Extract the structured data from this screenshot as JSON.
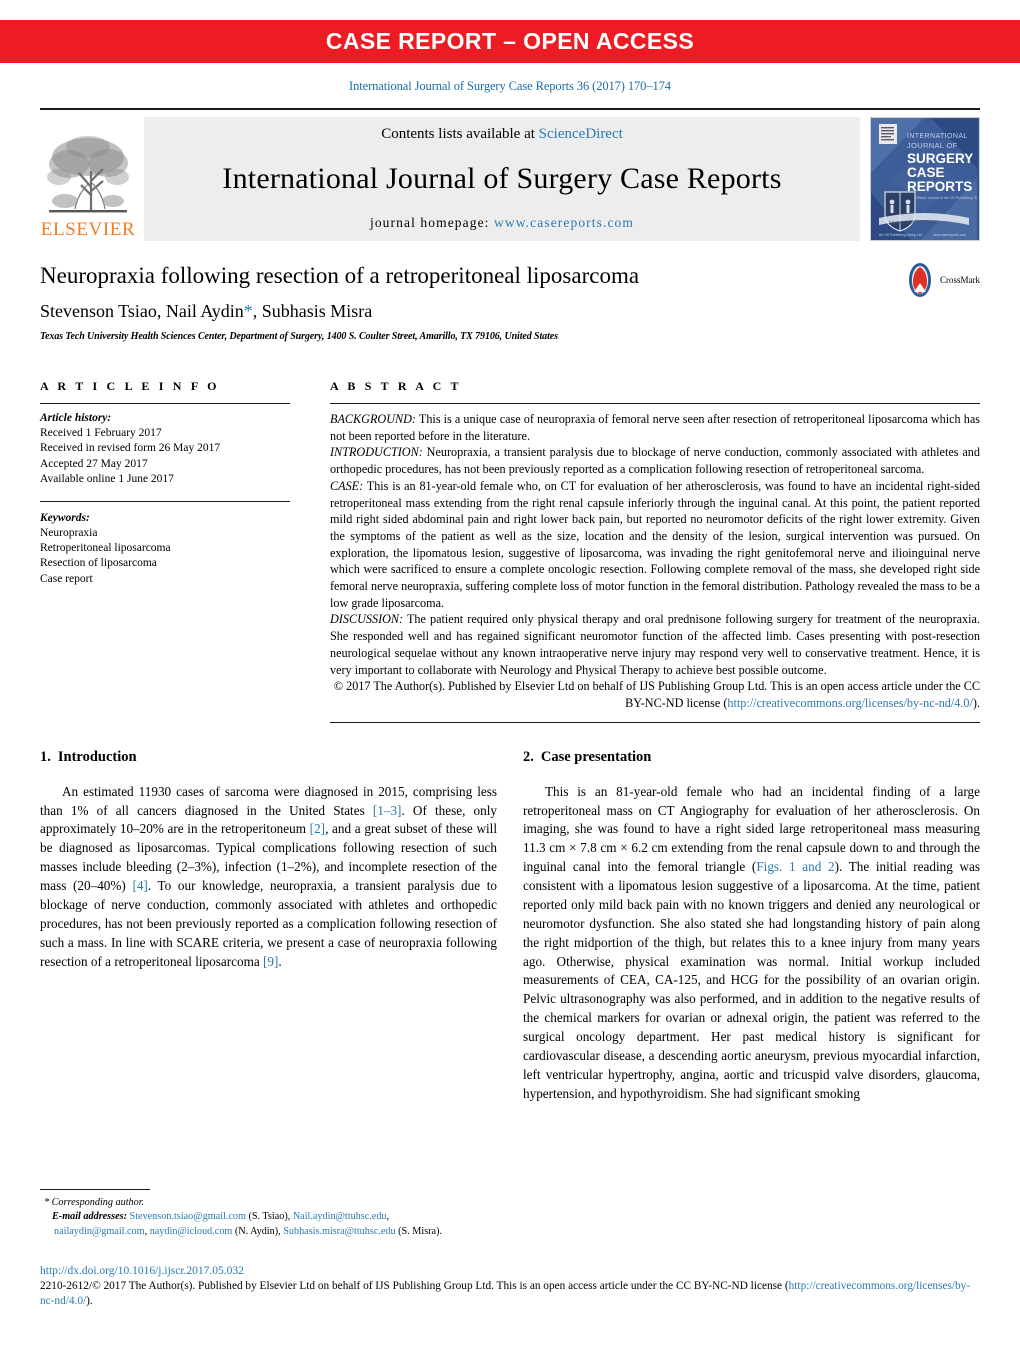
{
  "banner": {
    "text": "CASE REPORT – OPEN ACCESS"
  },
  "citation": "International Journal of Surgery Case Reports 36 (2017) 170–174",
  "masthead": {
    "contents_prefix": "Contents lists available at ",
    "sciencedirect": "ScienceDirect",
    "journal_title": "International Journal of Surgery Case Reports",
    "homepage_prefix": "journal homepage: ",
    "homepage_url": "www.casereports.com",
    "elsevier_wordmark": "ELSEVIER",
    "cover": {
      "line1": "INTERNATIONAL",
      "line2": "JOURNAL OF",
      "line3": "SURGERY",
      "line4": "CASE",
      "line5": "REPORTS"
    }
  },
  "article": {
    "title": "Neuropraxia following resection of a retroperitoneal liposarcoma",
    "authors_pre": "Stevenson Tsiao, Nail Aydin",
    "authors_star": "*",
    "authors_post": ", Subhasis Misra",
    "affiliation": "Texas Tech University Health Sciences Center, Department of Surgery, 1400 S. Coulter Street, Amarillo, TX 79106, United States",
    "crossmark_label": "CrossMark"
  },
  "article_info": {
    "heading": "A R T I C L E   I N F O",
    "history_label": "Article history:",
    "history": [
      "Received 1 February 2017",
      "Received in revised form 26 May 2017",
      "Accepted 27 May 2017",
      "Available online 1 June 2017"
    ],
    "keywords_label": "Keywords:",
    "keywords": [
      "Neuropraxia",
      "Retroperitoneal liposarcoma",
      "Resection of liposarcoma",
      "Case report"
    ]
  },
  "abstract": {
    "heading": "A B S T R A C T",
    "background_tag": "BACKGROUND:",
    "background_text": " This is a unique case of neuropraxia of femoral nerve seen after resection of retroperitoneal liposarcoma which has not been reported before in the literature.",
    "introduction_tag": "INTRODUCTION:",
    "introduction_text": " Neuropraxia, a transient paralysis due to blockage of nerve conduction, commonly associated with athletes and orthopedic procedures, has not been previously reported as a complication following resection of retroperitoneal sarcoma.",
    "case_tag": "CASE:",
    "case_text": " This is an 81-year-old female who, on CT for evaluation of her atherosclerosis, was found to have an incidental right-sided retroperitoneal mass extending from the right renal capsule inferiorly through the inguinal canal. At this point, the patient reported mild right sided abdominal pain and right lower back pain, but reported no neuromotor deficits of the right lower extremity. Given the symptoms of the patient as well as the size, location and the density of the lesion, surgical intervention was pursued. On exploration, the lipomatous lesion, suggestive of liposarcoma, was invading the right genitofemoral nerve and ilioinguinal nerve which were sacrificed to ensure a complete oncologic resection. Following complete removal of the mass, she developed right side femoral nerve neuropraxia, suffering complete loss of motor function in the femoral distribution. Pathology revealed the mass to be a low grade liposarcoma.",
    "discussion_tag": "DISCUSSION:",
    "discussion_text": " The patient required only physical therapy and oral prednisone following surgery for treatment of the neuropraxia. She responded well and has regained significant neuromotor function of the affected limb. Cases presenting with post-resection neurological sequelae without any known intraoperative nerve injury may respond very well to conservative treatment. Hence, it is very important to collaborate with Neurology and Physical Therapy to achieve best possible outcome.",
    "copyright_text": "© 2017 The Author(s). Published by Elsevier Ltd on behalf of IJS Publishing Group Ltd. This is an open access article under the CC BY-NC-ND license (",
    "copyright_link": "http://creativecommons.org/licenses/by-nc-nd/4.0/",
    "copyright_tail": ")."
  },
  "sections": {
    "introduction": {
      "number": "1.",
      "heading": "Introduction",
      "p1_a": "An estimated 11930 cases of sarcoma were diagnosed in 2015, comprising less than 1% of all cancers diagnosed in the United States ",
      "ref1": "[1–3]",
      "p1_b": ". Of these, only approximately 10–20% are in the retroperitoneum ",
      "ref2": "[2]",
      "p1_c": ", and a great subset of these will be diagnosed as liposarcomas. Typical complications following resection of such masses include bleeding (2–3%), infection (1–2%), and incomplete resection of the mass (20–40%) ",
      "ref3": "[4]",
      "p1_d": ". To our knowledge, neuropraxia, a transient paralysis due to blockage of nerve conduction, commonly associated with athletes and orthopedic procedures, has not been previously reported as a complication following resection of such a mass. In line with SCARE criteria, we present a case of neuropraxia following resection of a retroperitoneal liposarcoma ",
      "ref4": "[9]",
      "p1_e": "."
    },
    "case_presentation": {
      "number": "2.",
      "heading": "Case presentation",
      "p1_a": "This is an 81-year-old female who had an incidental finding of a large retroperitoneal mass on CT Angiography for evaluation of her atherosclerosis. On imaging, she was found to have a right sided large retroperitoneal mass measuring 11.3 cm × 7.8 cm × 6.2 cm extending from the renal capsule down to and through the inguinal canal into the femoral triangle (",
      "figref": "Figs. 1 and 2",
      "p1_b": "). The initial reading was consistent with a lipomatous lesion suggestive of a liposarcoma. At the time, patient reported only mild back pain with no known triggers and denied any neurological or neuromotor dysfunction. She also stated she had longstanding history of pain along the right midportion of the thigh, but relates this to a knee injury from many years ago. Otherwise, physical examination was normal. Initial workup included measurements of CEA, CA-125, and HCG for the possibility of an ovarian origin. Pelvic ultrasonography was also performed, and in addition to the negative results of the chemical markers for ovarian or adnexal origin, the patient was referred to the surgical oncology department. Her past medical history is significant for cardiovascular disease, a descending aortic aneurysm, previous myocardial infarction, left ventricular hypertrophy, angina, aortic and tricuspid valve disorders, glaucoma, hypertension, and hypothyroidism. She had significant smoking"
    }
  },
  "footnote": {
    "corresponding": "* Corresponding author.",
    "email_label": "E-mail addresses:",
    "email1": "Stevenson.tsiao@gmail.com",
    "email1_attr": " (S. Tsiao), ",
    "email2": "Nail.aydin@ttuhsc.edu",
    "email2_sep": ", ",
    "email3": "nailaydin@gmail.com",
    "email3_sep": ", ",
    "email4": "naydin@icloud.com",
    "email4_attr": " (N. Aydin), ",
    "email5": "Subhasis.misra@ttuhsc.edu",
    "email5_attr": " (S. Misra)."
  },
  "bottom": {
    "doi": "http://dx.doi.org/10.1016/j.ijscr.2017.05.032",
    "issn_prefix": "2210-2612/© 2017 The Author(s). Published by Elsevier Ltd on behalf of IJS Publishing Group Ltd. This is an open access article under the CC BY-NC-ND license (",
    "issn_link": "http://creativecommons.org/licenses/by-nc-nd/4.0/",
    "issn_tail": ")."
  },
  "colors": {
    "banner_red": "#ed1c24",
    "link_blue": "#2a7ab0",
    "elsevier_orange": "#f47c20",
    "cover_blue": "#35538c"
  }
}
